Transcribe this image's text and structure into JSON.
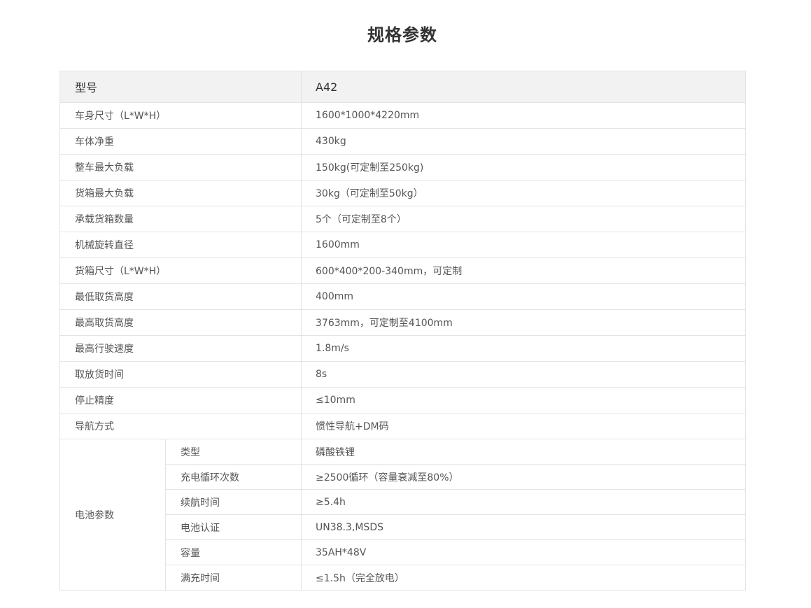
{
  "page": {
    "title": "规格参数"
  },
  "table": {
    "header": {
      "label": "型号",
      "value": "A42"
    },
    "rows": [
      {
        "label": "车身尺寸（L*W*H）",
        "value": "1600*1000*4220mm"
      },
      {
        "label": "车体净重",
        "value": "430kg"
      },
      {
        "label": "整车最大负载",
        "value": "150kg(可定制至250kg)"
      },
      {
        "label": "货箱最大负载",
        "value": "30kg（可定制至50kg）"
      },
      {
        "label": "承载货箱数量",
        "value": "5个（可定制至8个）"
      },
      {
        "label": "机械旋转直径",
        "value": "1600mm"
      },
      {
        "label": "货箱尺寸（L*W*H）",
        "value": "600*400*200-340mm，可定制"
      },
      {
        "label": "最低取货高度",
        "value": "400mm"
      },
      {
        "label": "最高取货高度",
        "value": "3763mm，可定制至4100mm"
      },
      {
        "label": "最高行驶速度",
        "value": "1.8m/s"
      },
      {
        "label": "取放货时间",
        "value": "8s"
      },
      {
        "label": "停止精度",
        "value": "≤10mm"
      },
      {
        "label": "导航方式",
        "value": "惯性导航+DM码"
      }
    ],
    "battery": {
      "group_label": "电池参数",
      "rows": [
        {
          "label": "类型",
          "value": "磷酸铁锂"
        },
        {
          "label": "充电循环次数",
          "value": "≥2500循环（容量衰减至80%）"
        },
        {
          "label": "续航时间",
          "value": "≥5.4h"
        },
        {
          "label": "电池认证",
          "value": "UN38.3,MSDS"
        },
        {
          "label": "容量",
          "value": "35AH*48V"
        },
        {
          "label": "满充时间",
          "value": "≤1.5h（完全放电）"
        }
      ]
    }
  },
  "colors": {
    "header_bg": "#f2f2f2",
    "border": "#e3e3e3",
    "text": "#555555",
    "title": "#333333"
  }
}
